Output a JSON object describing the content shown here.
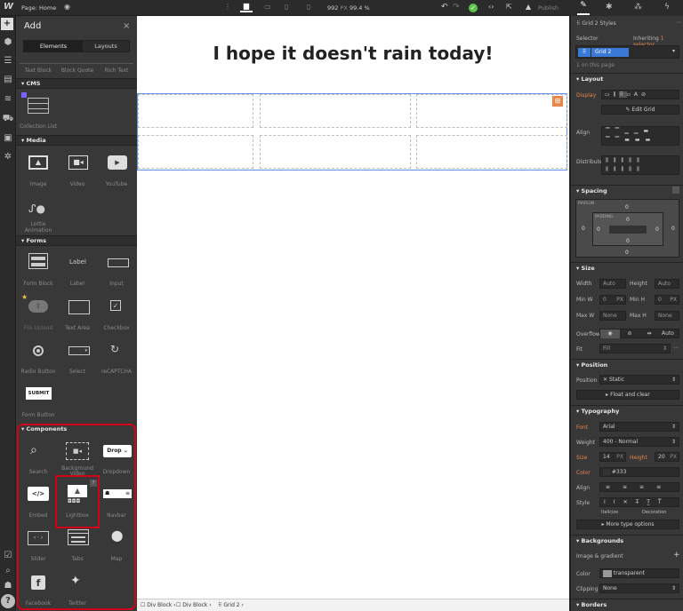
{
  "topbar": {
    "page_label": "Page: Home",
    "width_value": "992",
    "width_unit": "PX",
    "zoom": "99.4 %",
    "publish_label": "Publish"
  },
  "addpanel": {
    "title": "Add",
    "tabs": [
      "Elements",
      "Layouts"
    ],
    "top_labels": [
      "Text Block",
      "Block Quote",
      "Rich Text"
    ],
    "sections": {
      "cms": "CMS",
      "media": "Media",
      "forms": "Forms",
      "components": "Components"
    },
    "cms_items": [
      "Collection List"
    ],
    "media_items": [
      "Image",
      "Video",
      "YouTube"
    ],
    "lottie": [
      "Lottie",
      "Animation"
    ],
    "forms_items_row1": [
      "Form Block",
      "Label",
      "Input"
    ],
    "forms_label_text": "Label",
    "forms_items_row2": [
      "File Upload",
      "Text Area",
      "Checkbox"
    ],
    "forms_items_row3": [
      "Radio Button",
      "Select",
      "reCAPTCHA"
    ],
    "submit_text": "SUBMIT",
    "form_button": "Form Button",
    "components_row1": [
      "Search",
      "Background Video",
      "Dropdown"
    ],
    "dropdown_text": "Drop",
    "components_row2": [
      "Embed",
      "Lightbox",
      "Navbar"
    ],
    "components_row3": [
      "Slider",
      "Tabs",
      "Map"
    ],
    "components_row4": [
      "Facebook",
      "Twitter"
    ]
  },
  "canvas": {
    "heading": "I hope it doesn't rain today!"
  },
  "breadcrumbs": [
    "Div Block",
    "Div Block",
    "Grid 2"
  ],
  "rpanel": {
    "styles_title": "Grid 2 Styles",
    "selector_label": "Selector",
    "inheriting_label": "Inheriting",
    "inheriting_value": "1 selector",
    "selector_chip": "Grid 2",
    "on_page": "1 on this page",
    "layout": "Layout",
    "display_label": "Display",
    "edit_grid": "Edit Grid",
    "align_label": "Align",
    "distribute_label": "Distribute",
    "spacing": "Spacing",
    "margin_label": "MARGIN",
    "padding_label": "PADDING",
    "spacing_vals": [
      "0",
      "0",
      "0",
      "0",
      "0",
      "0",
      "0",
      "0"
    ],
    "size": "Size",
    "width_label": "Width",
    "height_label": "Height",
    "auto": "Auto",
    "minw_label": "Min W",
    "minh_label": "Min H",
    "min_val": "0",
    "px": "PX",
    "maxw_label": "Max W",
    "maxh_label": "Max H",
    "none": "None",
    "overflow_label": "Overflow",
    "overflow_auto": "Auto",
    "fit_label": "Fit",
    "fit_value": "Fill",
    "position": "Position",
    "position_label": "Position",
    "position_value": "Static",
    "float_clear": "Float and clear",
    "typography": "Typography",
    "font_label": "Font",
    "font_value": "Arial",
    "weight_label": "Weight",
    "weight_value": "400 - Normal",
    "size_label": "Size",
    "size_value": "14",
    "size_unit": "PX",
    "lheight_label": "Height",
    "lheight_value": "20",
    "color_label": "Color",
    "color_value": "#333",
    "talign_label": "Align",
    "style_label": "Style",
    "italicize": "Italicize",
    "decoration": "Decoration",
    "more_type": "More type options",
    "backgrounds": "Backgrounds",
    "image_gradient": "Image & gradient",
    "bg_color_label": "Color",
    "bg_color_value": "transparent",
    "clipping_label": "Clipping",
    "clipping_value": "None",
    "borders": "Borders"
  },
  "colors": {
    "accent_blue": "#4a90e2",
    "highlight_red": "#d0021b",
    "orange_label": "#e8864a",
    "chip_blue": "#3b79d6"
  }
}
